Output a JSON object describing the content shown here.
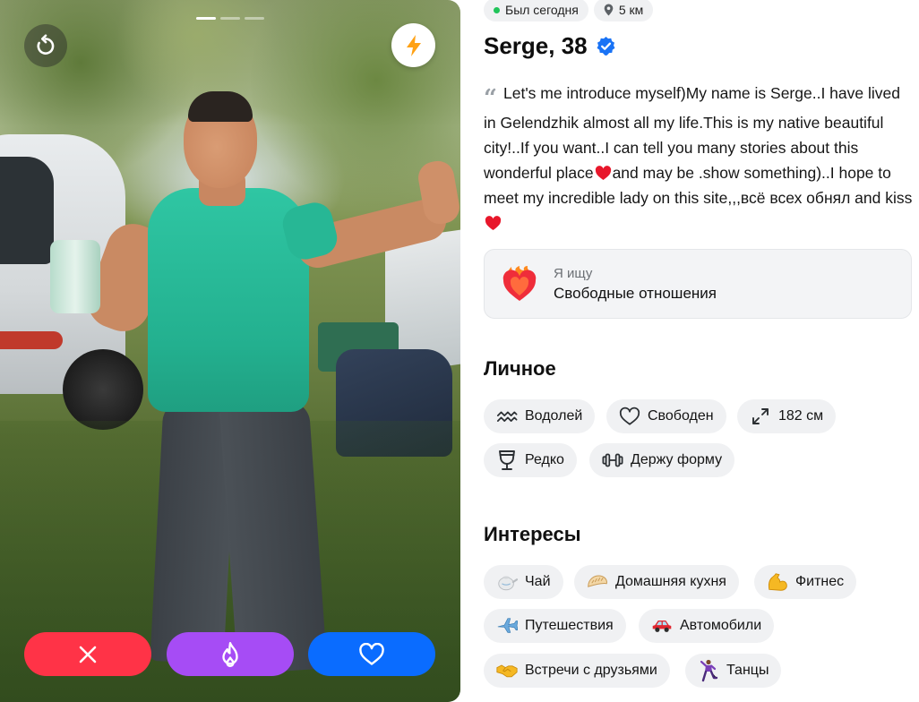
{
  "photo": {
    "page_indicator": {
      "count": 3,
      "active": 0
    },
    "icons": {
      "rewind": "rewind-icon",
      "boost": "lightning-icon"
    },
    "actions": [
      {
        "id": "dislike",
        "icon": "close-icon",
        "color": "#ff3347"
      },
      {
        "id": "super_like",
        "icon": "flame-icon",
        "color": "#a64cf5"
      },
      {
        "id": "like",
        "icon": "heart-icon",
        "color": "#0a6cff"
      }
    ]
  },
  "profile": {
    "status": {
      "last_seen": "Был сегодня",
      "distance": "5 км",
      "online_color": "#21c45a"
    },
    "name_age": "Serge, 38",
    "verified_icon": "verified-badge-icon",
    "bio": {
      "part1": "Let's me introduce myself)My name is Serge..I have lived in Gelendzhik almost all my life.This is my native beautiful city!..If you want..I can tell you many stories about this wonderful place",
      "part2": "and may be .show something)..I hope to meet my incredible lady on this site,,,всё всех обнял and kiss"
    },
    "looking_for": {
      "label": "Я ищу",
      "value": "Свободные отношения",
      "icon": "flaming-heart-icon"
    }
  },
  "personal": {
    "title": "Личное",
    "chips": [
      {
        "label": "Водолей",
        "icon": "aquarius-icon"
      },
      {
        "label": "Свободен",
        "icon": "heart-outline-icon"
      },
      {
        "label": "182 см",
        "icon": "height-arrows-icon"
      },
      {
        "label": "Редко",
        "icon": "wine-glass-icon"
      },
      {
        "label": "Держу форму",
        "icon": "dumbbell-icon"
      }
    ]
  },
  "interests": {
    "title": "Интересы",
    "chips": [
      {
        "label": "Чай",
        "icon": "teapot-icon",
        "glyph": "🫖"
      },
      {
        "label": "Домашняя кухня",
        "icon": "dumpling-icon",
        "glyph": "🥟"
      },
      {
        "label": "Фитнес",
        "icon": "flexed-biceps-icon",
        "glyph": "💪"
      },
      {
        "label": "Путешествия",
        "icon": "airplane-icon",
        "glyph": "✈"
      },
      {
        "label": "Автомобили",
        "icon": "car-icon",
        "glyph": "🚗"
      },
      {
        "label": "Встречи с друзьями",
        "icon": "handshake-icon",
        "glyph": "🤝"
      },
      {
        "label": "Танцы",
        "icon": "dancer-icon",
        "glyph": "🕺"
      }
    ]
  }
}
